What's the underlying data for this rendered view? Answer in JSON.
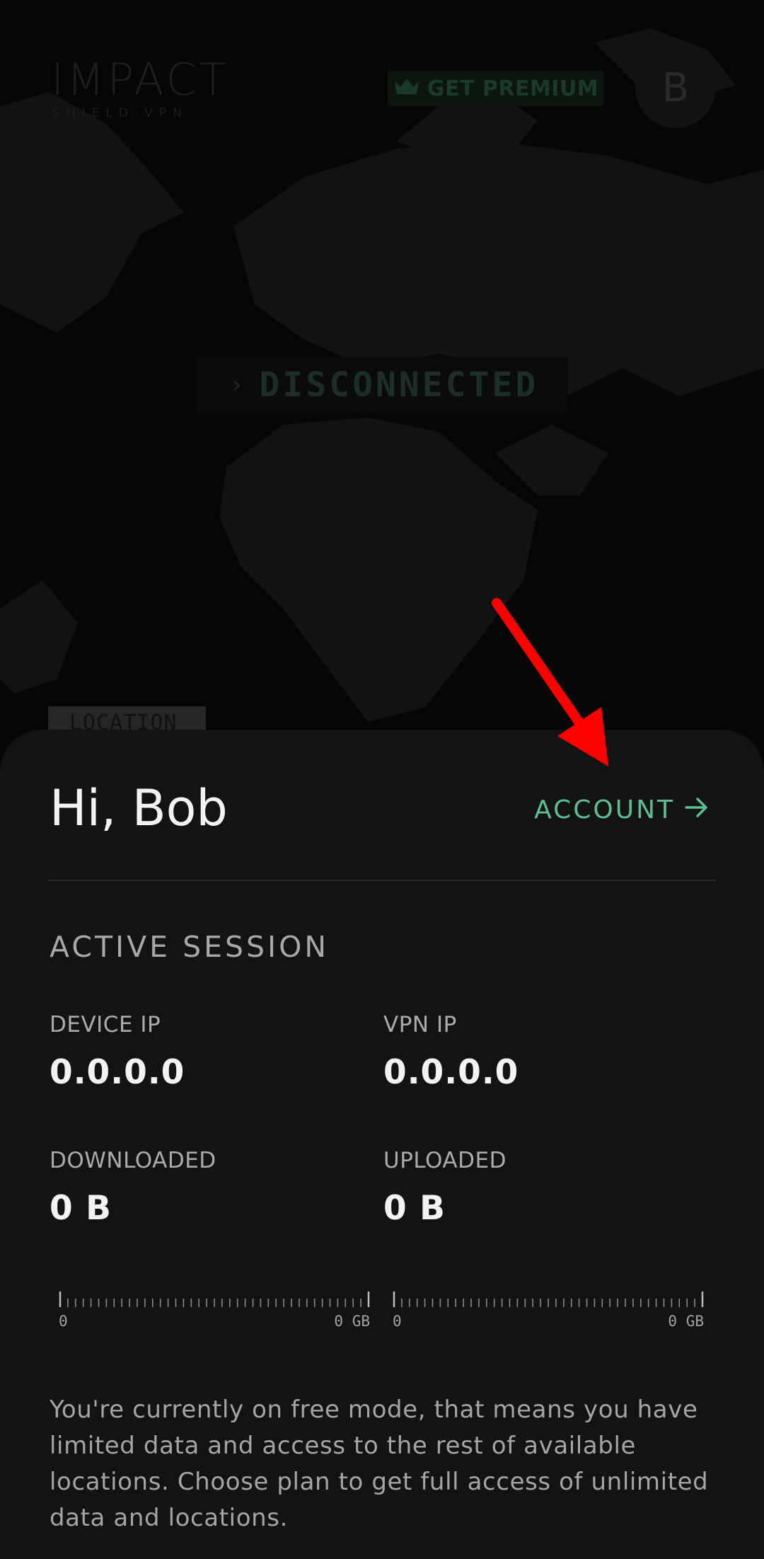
{
  "header": {
    "logo_main": "IMPACT",
    "logo_sub": "SHIELD·VPN",
    "premium_label": "GET PREMIUM",
    "avatar_initial": "B"
  },
  "status": {
    "label": "DISCONNECTED"
  },
  "location_tag": "LOCATION",
  "panel": {
    "greeting": "Hi, Bob",
    "account_label": "ACCOUNT",
    "section_title": "ACTIVE SESSION",
    "stats": {
      "device_ip_label": "DEVICE IP",
      "device_ip": "0.0.0.0",
      "vpn_ip_label": "VPN IP",
      "vpn_ip": "0.0.0.0",
      "downloaded_label": "DOWNLOADED",
      "downloaded": "0 B",
      "uploaded_label": "UPLOADED",
      "uploaded": "0 B"
    },
    "gauges": [
      {
        "min": "0",
        "max": "0 GB"
      },
      {
        "min": "0",
        "max": "0 GB"
      }
    ],
    "note": "You're currently on free mode, that means you have limited data and access to the rest of available locations. Choose plan to get full access of unlimited data and locations."
  },
  "colors": {
    "accent": "#5bbf8e",
    "panel": "#131313",
    "annotation_arrow": "#ff0000"
  }
}
